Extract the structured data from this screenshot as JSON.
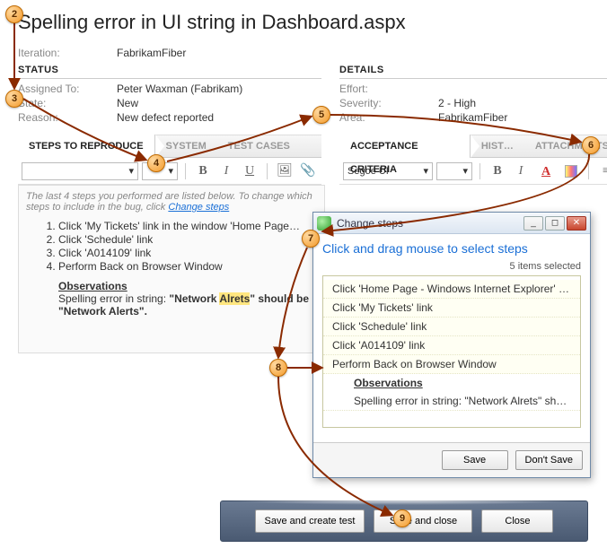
{
  "title": "Spelling error in UI string in Dashboard.aspx",
  "iteration": {
    "label": "Iteration:",
    "value": "FabrikamFiber"
  },
  "left": {
    "header": "STATUS",
    "assignedTo": {
      "label": "Assigned To:",
      "value": "Peter Waxman (Fabrikam)"
    },
    "state": {
      "label": "State:",
      "value": "New"
    },
    "reason": {
      "label": "Reason:",
      "value": "New defect reported"
    },
    "tabs": {
      "steps": "STEPS TO REPRODUCE",
      "system": "SYSTEM",
      "testcases": "TEST CASES"
    },
    "toolbar": {
      "font": "",
      "size": ""
    },
    "hint_prefix": "The last 4 steps you performed are listed below. To change which steps to include in the bug, click ",
    "hint_link": "Change steps",
    "steps": [
      "Click 'My Tickets' link in the window 'Home Page…",
      "Click 'Schedule' link",
      "Click 'A014109' link",
      "Perform Back on Browser Window"
    ],
    "obs_head": "Observations",
    "obs_line1a": "Spelling error in string: ",
    "obs_line1b": "\"Network ",
    "obs_hl": "Alrets",
    "obs_line1c": "\" should be ",
    "obs_line2": "\"Network Alerts\"."
  },
  "right": {
    "header": "DETAILS",
    "effort": {
      "label": "Effort:",
      "value": ""
    },
    "severity": {
      "label": "Severity:",
      "value": "2 - High"
    },
    "area": {
      "label": "Area:",
      "value": "FabrikamFiber"
    },
    "tabs": {
      "accept": "ACCEPTANCE CRITERIA",
      "history": "HIST…",
      "attach": "ATTACHMENTS"
    },
    "toolbar": {
      "font": "Segoe UI",
      "size": ""
    }
  },
  "dialog": {
    "title": "Change steps",
    "instr": "Click and drag mouse to select steps",
    "selected": "5 items selected",
    "items": [
      "Click 'Home Page - Windows Internet Explorer' t…",
      "Click 'My Tickets' link",
      "Click 'Schedule' link",
      "Click 'A014109' link",
      "Perform Back on Browser Window"
    ],
    "obs_head": "Observations",
    "obs_line": "Spelling error in string: \"Network Alrets\" should…",
    "save": "Save",
    "dontsave": "Don't Save"
  },
  "bottom": {
    "saveCreate": "Save and create test",
    "saveClose": "Save and close",
    "close": "Close"
  },
  "callouts": {
    "c2": "2",
    "c3": "3",
    "c4": "4",
    "c5": "5",
    "c6": "6",
    "c7": "7",
    "c8": "8",
    "c9": "9"
  }
}
